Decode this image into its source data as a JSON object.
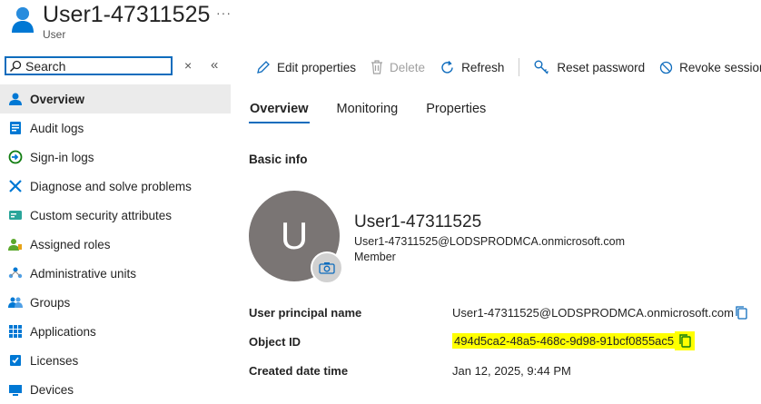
{
  "header": {
    "title": "User1-47311525",
    "subtitle": "User",
    "more": "···"
  },
  "search": {
    "placeholder": "Search",
    "clear": "×",
    "collapse": "«"
  },
  "sidebar": {
    "items": [
      {
        "label": "Overview",
        "icon": "user-icon"
      },
      {
        "label": "Audit logs",
        "icon": "audit-logs-icon"
      },
      {
        "label": "Sign-in logs",
        "icon": "sign-in-icon"
      },
      {
        "label": "Diagnose and solve problems",
        "icon": "wrench-icon"
      },
      {
        "label": "Custom security attributes",
        "icon": "attributes-icon"
      },
      {
        "label": "Assigned roles",
        "icon": "roles-icon"
      },
      {
        "label": "Administrative units",
        "icon": "admin-units-icon"
      },
      {
        "label": "Groups",
        "icon": "groups-icon"
      },
      {
        "label": "Applications",
        "icon": "applications-icon"
      },
      {
        "label": "Licenses",
        "icon": "licenses-icon"
      },
      {
        "label": "Devices",
        "icon": "devices-icon"
      }
    ]
  },
  "toolbar": {
    "edit": "Edit properties",
    "delete": "Delete",
    "refresh": "Refresh",
    "reset_password": "Reset password",
    "revoke": "Revoke sessions"
  },
  "tabs": [
    "Overview",
    "Monitoring",
    "Properties"
  ],
  "section_title": "Basic info",
  "profile": {
    "initial": "U",
    "display_name": "User1-47311525",
    "email": "User1-47311525@LODSPRODMCA.onmicrosoft.com",
    "user_type": "Member"
  },
  "properties": {
    "upn_label": "User principal name",
    "upn_value": "User1-47311525@LODSPRODMCA.onmicrosoft.com",
    "objectid_label": "Object ID",
    "objectid_value": "494d5ca2-48a5-468c-9d98-91bcf0855ac5",
    "created_label": "Created date time",
    "created_value": "Jan 12, 2025, 9:44 PM"
  },
  "colors": {
    "accent": "#0f6cbd",
    "highlight": "#ffff00",
    "avatar": "#7a7574",
    "active_nav": "#ebebeb"
  }
}
